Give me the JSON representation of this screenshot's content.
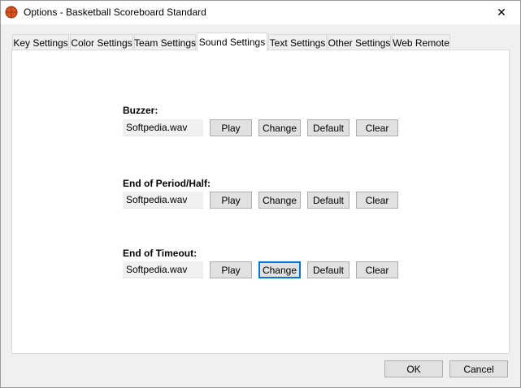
{
  "window": {
    "title": "Options - Basketball Scoreboard Standard",
    "close_glyph": "✕"
  },
  "tabs": [
    {
      "label": "Key Settings",
      "active": false
    },
    {
      "label": "Color Settings",
      "active": false
    },
    {
      "label": "Team Settings",
      "active": false
    },
    {
      "label": "Sound Settings",
      "active": true
    },
    {
      "label": "Text Settings",
      "active": false
    },
    {
      "label": "Other Settings",
      "active": false
    },
    {
      "label": "Web Remote",
      "active": false
    }
  ],
  "sounds": [
    {
      "label": "Buzzer:",
      "file": "Softpedia.wav"
    },
    {
      "label": "End of Period/Half:",
      "file": "Softpedia.wav"
    },
    {
      "label": "End of Timeout:",
      "file": "Softpedia.wav"
    }
  ],
  "buttons": {
    "play": "Play",
    "change": "Change",
    "default": "Default",
    "clear": "Clear"
  },
  "footer": {
    "ok": "OK",
    "cancel": "Cancel"
  },
  "colors": {
    "focus": "#0078d7",
    "ball": "#d9541e"
  }
}
